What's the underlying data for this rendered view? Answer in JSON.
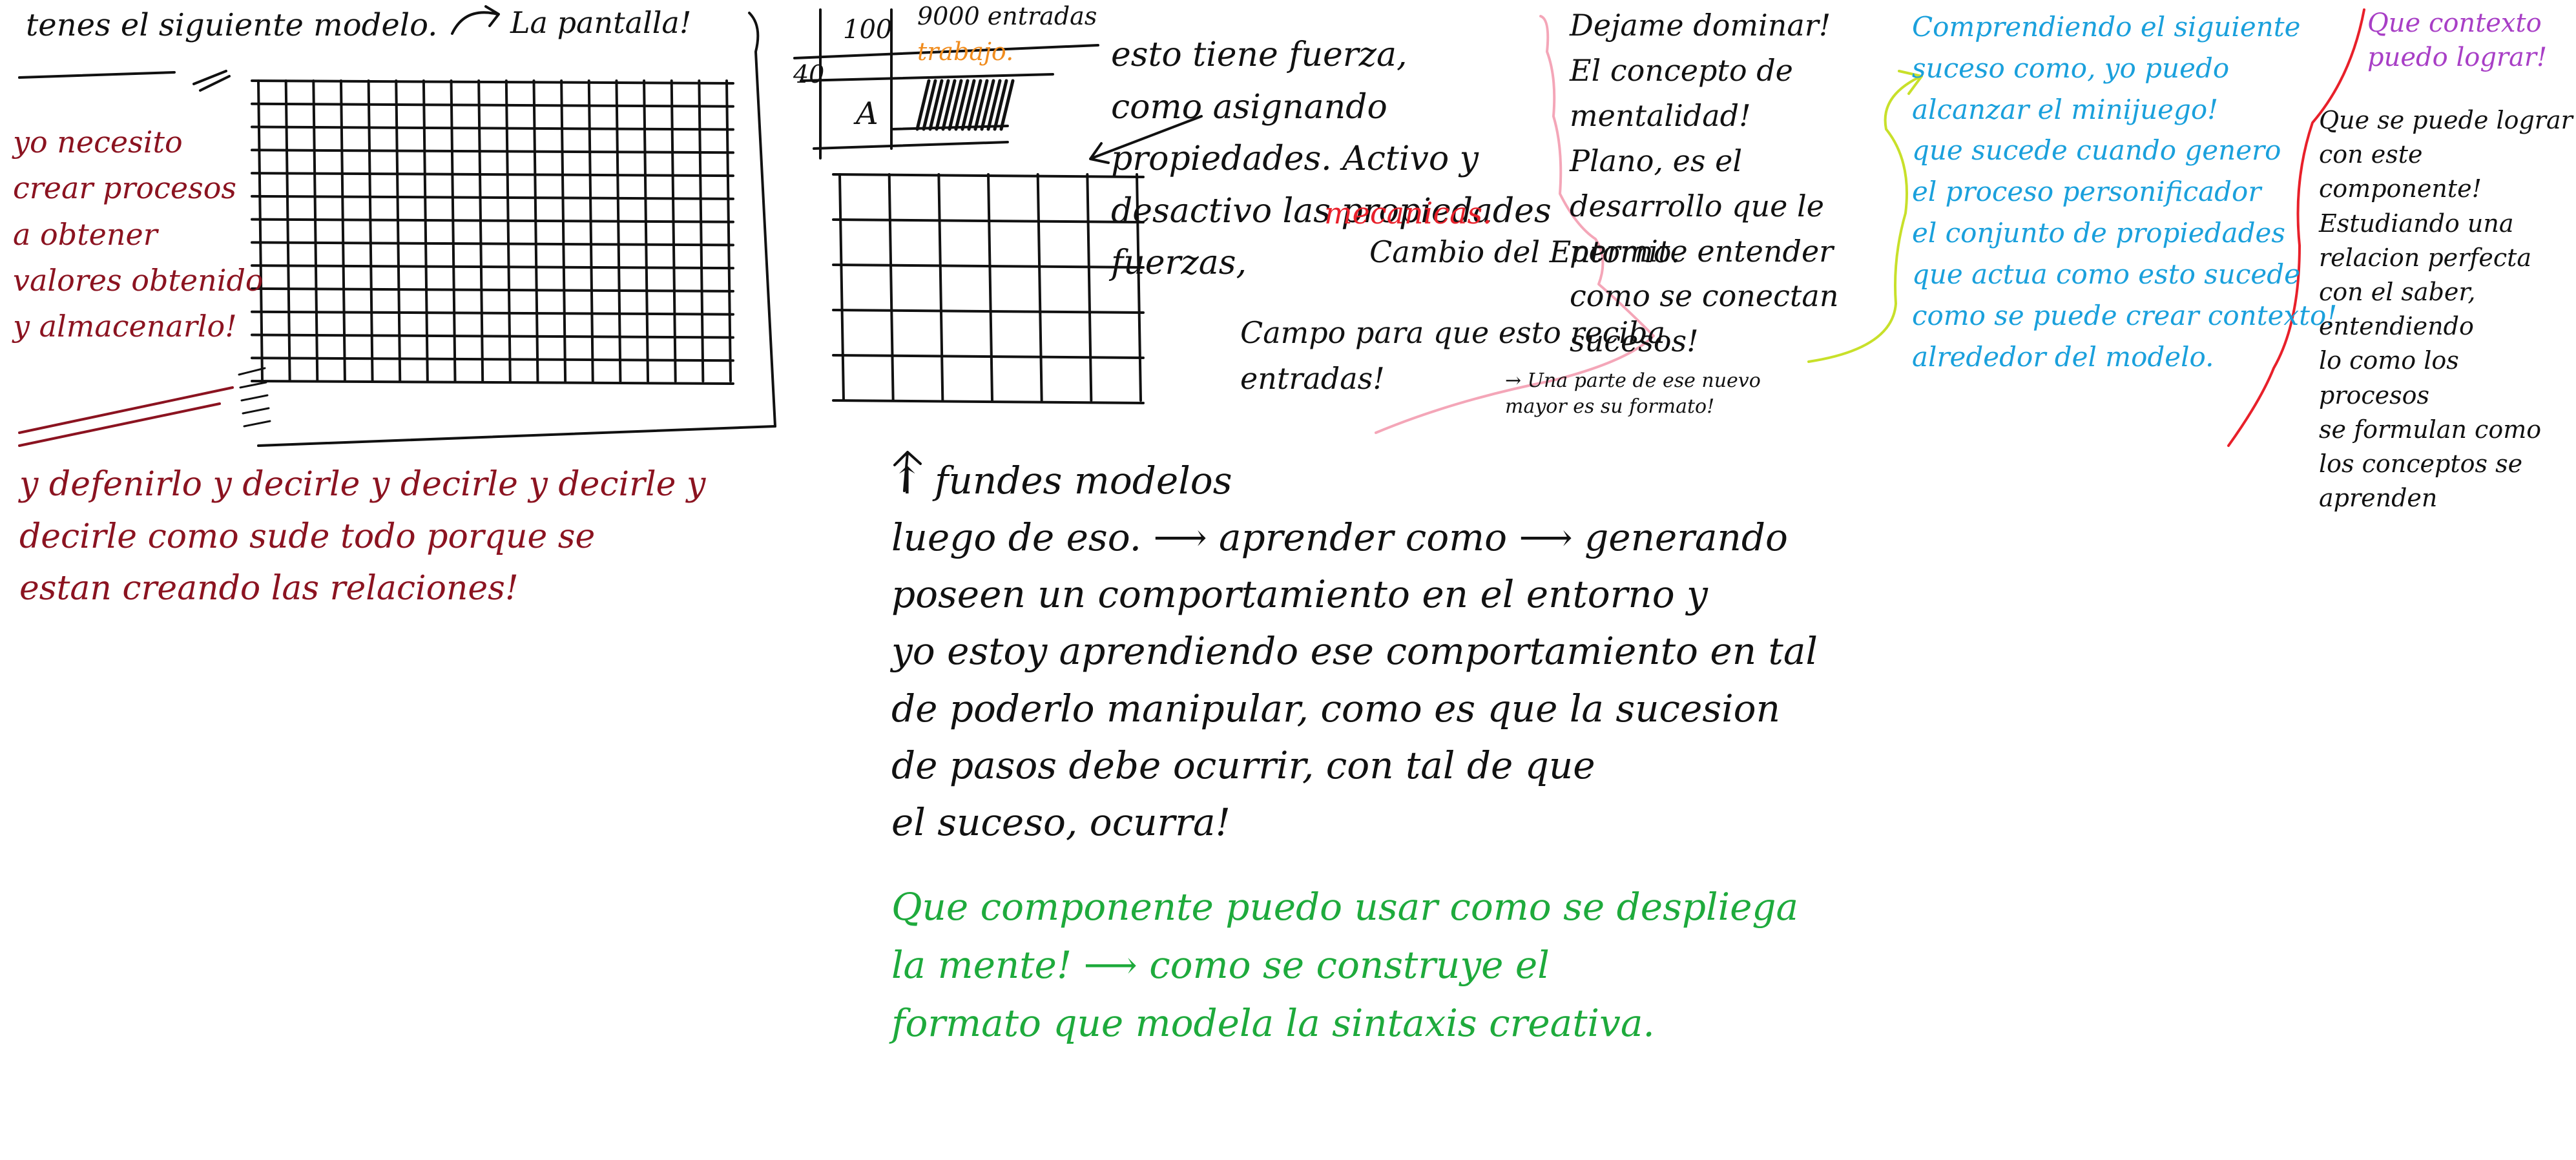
{
  "colors": {
    "black": "#111111",
    "dark_red": "#8b1320",
    "blue": "#1aa0dc",
    "green": "#1eaa3c",
    "purple": "#a83fc6",
    "orange": "#f08c1e",
    "bright_red": "#e8202a",
    "pink": "#f4a6b8",
    "yellow_green": "#c8e02a",
    "background": "#ffffff"
  },
  "notes": {
    "header": "tenes el siguiente modelo.",
    "pantalla": "La pantalla!",
    "yo_necesito": "yo necesito\ncrear procesos\na obtener\nvalores obtenido\ny almacenarlo!",
    "defenirlo": "y defenirlo y decirle y decirle y decirle y\ndecirle como sude todo porque se\nestan creando las relaciones!",
    "table_100": "100",
    "table_9000": "9000 entradas",
    "table_40": "40",
    "table_trabajo": "trabajo.",
    "table_A": "A",
    "fuerza": "esto tiene fuerza,\ncomo asignando\npropiedades. Activo y\ndesactivo las propiedades\nfuerzas,",
    "mecanicas": "mecanicas.",
    "cambio": "Cambio del Entorno.",
    "campo": "Campo para que esto reciba\nentradas!",
    "dejame": "Dejame dominar!\nEl concepto de\nmentalidad!\nPlano, es el\ndesarrollo que le\npermite entender\ncomo se conectan\nsucesos!",
    "parte": "→ Una parte de ese nuevo\nmayor es su formato!",
    "comprendiendo": "Comprendiendo el siguiente\nsuceso como, yo puedo\nalcanzar el minijuego!\nque sucede cuando genero\nel proceso personificador\nel conjunto de propiedades\nque actua como esto sucede\ncomo se puede crear contexto!\nalrededor del modelo.",
    "que_contexto": "Que contexto\npuedo lograr!",
    "que_se_puede": "Que se puede lograr\ncon este componente!\nEstudiando una\nrelacion perfecta\ncon el saber, entendiendo\nlo como los procesos\nse formulan como\nlos conceptos se\naprenden",
    "fundes": "↑ fundes modelos\nluego de eso. ⟶ aprender como ⟶ generando\nposeen un comportamiento en el entorno y\nyo estoy aprendiendo ese comportamiento en tal\nde poderlo manipular, como es que la sucesion\nde pasos debe ocurrir, con tal de que\nel suceso, ocurra!",
    "que_componente": "Que componente puedo usar como se despliega\nla mente! ⟶ como se construye el\nformato que modela la sintaxis creativa."
  }
}
